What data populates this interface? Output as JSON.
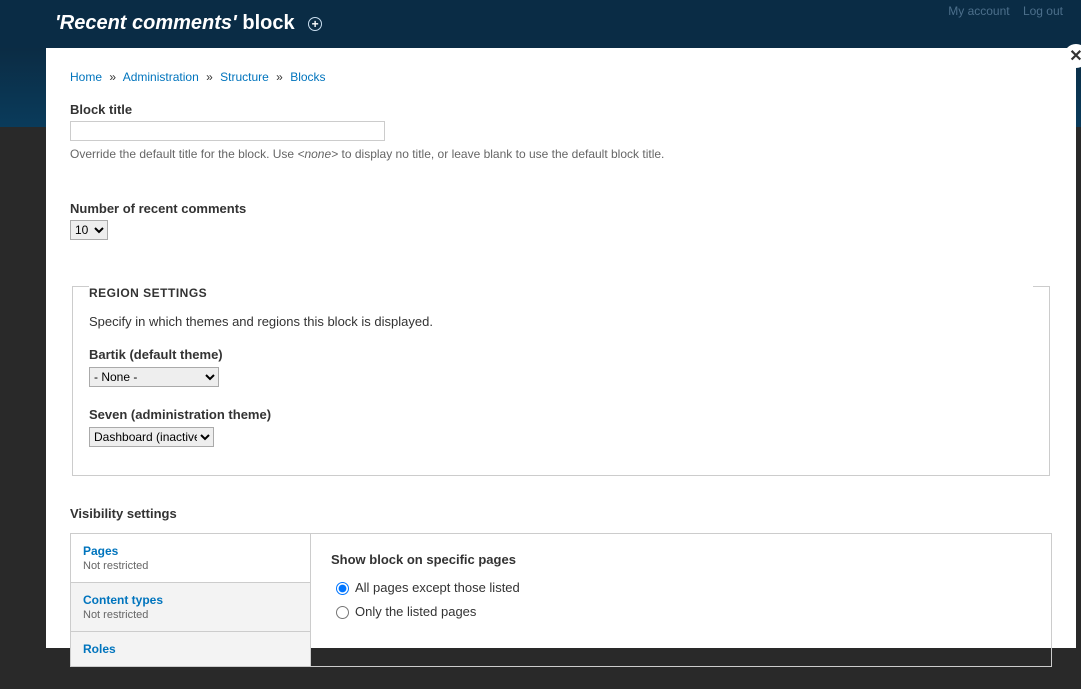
{
  "topbar": {
    "title_quoted": "'Recent comments'",
    "title_suffix": " block",
    "my_account": "My account",
    "log_out": "Log out"
  },
  "breadcrumb": {
    "home": "Home",
    "administration": "Administration",
    "structure": "Structure",
    "blocks": "Blocks"
  },
  "block_title": {
    "label": "Block title",
    "value": "",
    "help_prefix": "Override the default title for the block. Use ",
    "help_em": "<none>",
    "help_suffix": " to display no title, or leave blank to use the default block title."
  },
  "num_comments": {
    "label": "Number of recent comments",
    "value": "10"
  },
  "region": {
    "legend": "REGION SETTINGS",
    "desc": "Specify in which themes and regions this block is displayed.",
    "bartik_label": "Bartik (default theme)",
    "bartik_value": "- None -",
    "seven_label": "Seven (administration theme)",
    "seven_value": "Dashboard (inactive)"
  },
  "visibility": {
    "heading": "Visibility settings",
    "tabs": {
      "pages": {
        "title": "Pages",
        "sub": "Not restricted"
      },
      "content_types": {
        "title": "Content types",
        "sub": "Not restricted"
      },
      "roles": {
        "title": "Roles"
      }
    },
    "panel": {
      "title": "Show block on specific pages",
      "opt1": "All pages except those listed",
      "opt2": "Only the listed pages"
    }
  }
}
